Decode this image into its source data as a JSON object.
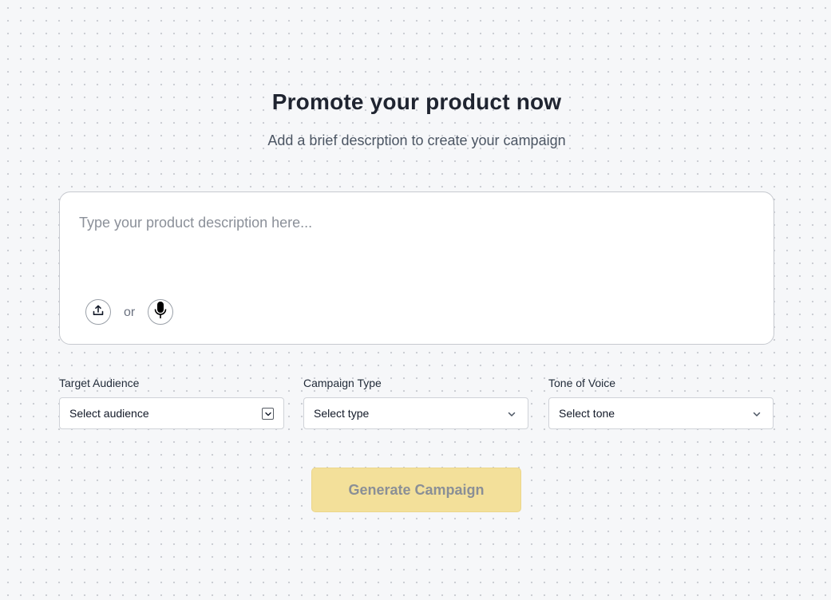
{
  "header": {
    "title": "Promote your product now",
    "subtitle": "Add a brief descrption to create your campaign"
  },
  "description": {
    "placeholder": "Type your product description here...",
    "value": "",
    "upload_icon": "upload-icon",
    "or_label": "or",
    "mic_icon": "microphone-icon"
  },
  "fields": {
    "audience": {
      "label": "Target Audience",
      "value": "Select audience"
    },
    "campaign_type": {
      "label": "Campaign Type",
      "value": "Select type"
    },
    "tone": {
      "label": "Tone of Voice",
      "value": "Select tone"
    }
  },
  "actions": {
    "generate_label": "Generate Campaign",
    "generate_color": "#f3e09a",
    "generate_disabled": true
  }
}
